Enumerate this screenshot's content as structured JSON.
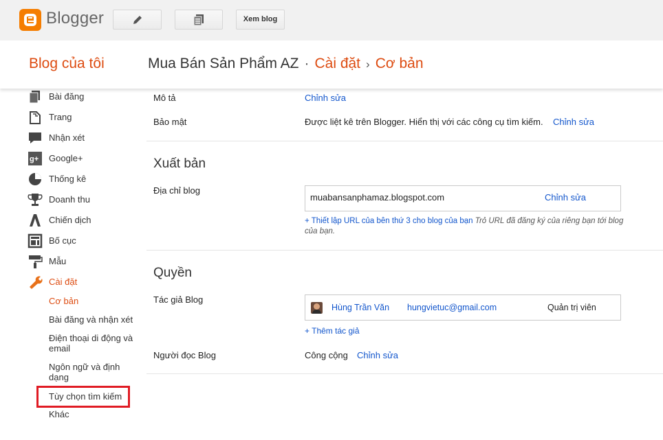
{
  "topbar": {
    "logo_text": "Blogger",
    "view_blog_label": "Xem blog"
  },
  "header": {
    "my_blogs": "Blog của tôi",
    "blog_name": "Mua Bán Sản Phẩm AZ",
    "dot": "·",
    "crumb_settings": "Cài đặt",
    "sep": "›",
    "crumb_basic": "Cơ bản"
  },
  "sidebar": {
    "items": [
      {
        "label": "Bài đăng",
        "icon": "posts-icon"
      },
      {
        "label": "Trang",
        "icon": "pages-icon"
      },
      {
        "label": "Nhận xét",
        "icon": "comments-icon"
      },
      {
        "label": "Google+",
        "icon": "google-plus-icon"
      },
      {
        "label": "Thống kê",
        "icon": "stats-icon"
      },
      {
        "label": "Doanh thu",
        "icon": "trophy-icon"
      },
      {
        "label": "Chiến dịch",
        "icon": "campaign-icon"
      },
      {
        "label": "Bố cục",
        "icon": "layout-icon"
      },
      {
        "label": "Mẫu",
        "icon": "template-roller-icon"
      },
      {
        "label": "Cài đặt",
        "icon": "wrench-icon"
      }
    ],
    "sub_items": [
      "Cơ bản",
      "Bài đăng và nhận xét",
      "Điện thoại di động và email",
      "Ngôn ngữ và định dạng",
      "Tùy chọn tìm kiếm",
      "Khác"
    ]
  },
  "main": {
    "description_label": "Mô tả",
    "description_edit": "Chỉnh sửa",
    "privacy_label": "Bảo mật",
    "privacy_value": "Được liệt kê trên Blogger. Hiển thị với các công cụ tìm kiếm.",
    "privacy_edit": "Chỉnh sửa",
    "publishing_title": "Xuất bản",
    "blog_address_label": "Địa chỉ blog",
    "blog_address": "muabansanphamaz.blogspot.com",
    "blog_address_edit": "Chỉnh sửa",
    "custom_domain_link": "+ Thiết lập URL của bên thứ 3 cho blog của bạn",
    "custom_domain_hint": " Trỏ URL đã đăng ký của riêng bạn tới blog của bạn.",
    "permissions_title": "Quyền",
    "authors_label": "Tác giả Blog",
    "author_name": "Hùng Trần Văn",
    "author_email": "hungvietuc@gmail.com",
    "author_role": "Quản trị viên",
    "add_author": "+ Thêm tác giả",
    "readers_label": "Người đọc Blog",
    "readers_value": "Công cộng",
    "readers_edit": "Chỉnh sửa"
  },
  "colors": {
    "accent": "#dd4b10",
    "link": "#1155cc",
    "highlight": "#e01b24",
    "logo": "#f57d00"
  }
}
